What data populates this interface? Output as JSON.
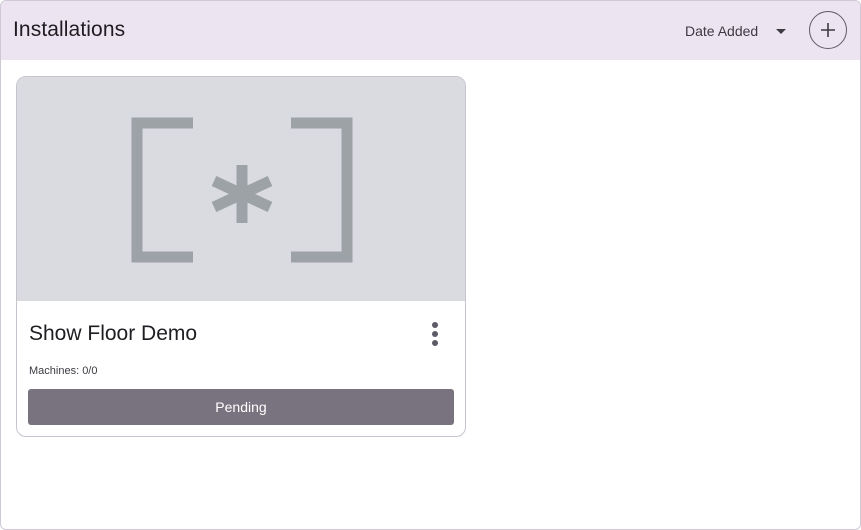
{
  "header": {
    "title": "Installations",
    "sort_label": "Date Added"
  },
  "icons": {
    "sort": "chevron-down-icon",
    "add": "plus-icon",
    "placeholder": "placeholder-image-icon",
    "more": "more-vert-icon"
  },
  "cards": [
    {
      "title": "Show Floor Demo",
      "machines_text": "Machines: 0/0",
      "status": "Pending",
      "status_color": "#79737f"
    }
  ],
  "colors": {
    "header_bg": "#ece4f1",
    "thumb_bg": "#d9dbe0",
    "placeholder_glyph": "#9da2a7"
  }
}
